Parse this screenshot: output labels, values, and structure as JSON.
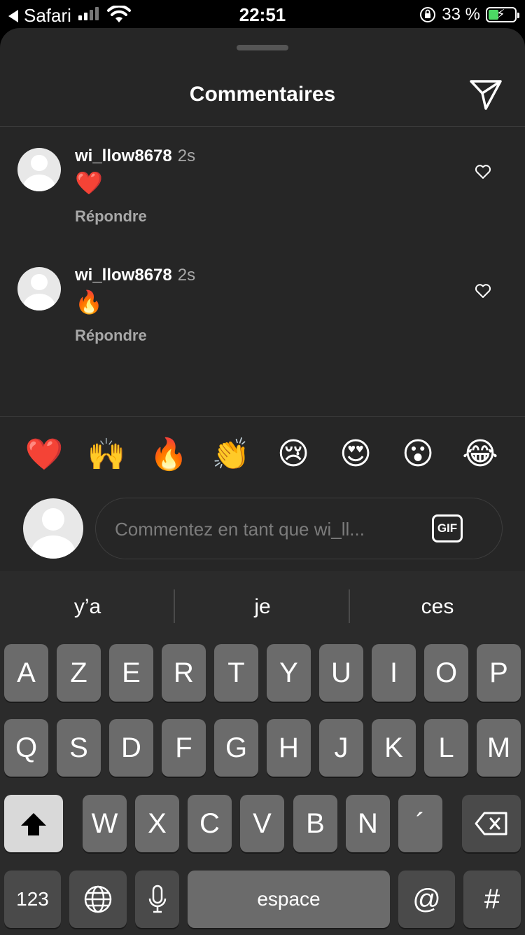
{
  "status": {
    "back_label": "Safari",
    "time": "22:51",
    "battery_pct": "33 %"
  },
  "sheet": {
    "title": "Commentaires"
  },
  "comments": [
    {
      "username": "wi_llow8678",
      "time": "2s",
      "emoji": "❤️",
      "reply": "Répondre"
    },
    {
      "username": "wi_llow8678",
      "time": "2s",
      "emoji": "🔥",
      "reply": "Répondre"
    }
  ],
  "reactions": [
    "❤️",
    "🙌",
    "🔥",
    "👏",
    "😢",
    "😍",
    "😮",
    "😂"
  ],
  "input": {
    "placeholder": "Commentez en tant que wi_ll...",
    "gif_label": "GIF"
  },
  "keyboard": {
    "suggestions": [
      "y’a",
      "je",
      "ces"
    ],
    "row1": [
      "A",
      "Z",
      "E",
      "R",
      "T",
      "Y",
      "U",
      "I",
      "O",
      "P"
    ],
    "row2": [
      "Q",
      "S",
      "D",
      "F",
      "G",
      "H",
      "J",
      "K",
      "L",
      "M"
    ],
    "row3": [
      "W",
      "X",
      "C",
      "V",
      "B",
      "N",
      "´"
    ],
    "numbers_label": "123",
    "space_label": "espace",
    "at_label": "@",
    "hash_label": "#"
  }
}
